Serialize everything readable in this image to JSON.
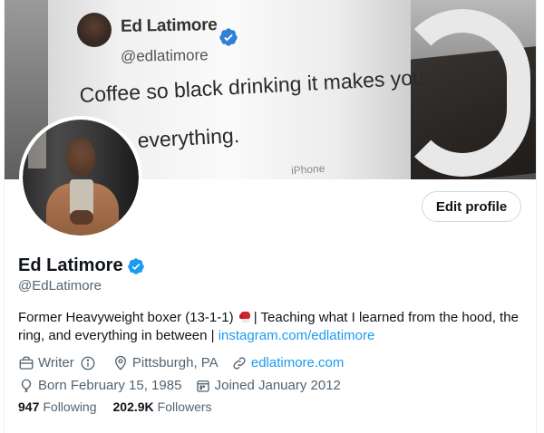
{
  "banner": {
    "tweet_name": "Ed Latimore",
    "tweet_handle": "@edlatimore",
    "tweet_line1": "Coffee so black drinking it makes you",
    "tweet_line2": "everything.",
    "tweet_footer": "iPhone"
  },
  "profile": {
    "display_name": "Ed Latimore",
    "handle": "@EdLatimore",
    "edit_label": "Edit profile",
    "bio_text": "Former Heavyweight boxer (13-1-1)",
    "bio_text2": "| Teaching what I learned from the hood, the ring, and everything in between |",
    "bio_link": "instagram.com/edlatimore",
    "meta": {
      "category": "Writer",
      "location": "Pittsburgh, PA",
      "website": "edlatimore.com",
      "born": "Born February 15, 1985",
      "joined": "Joined January 2012"
    },
    "following_count": "947",
    "following_label": "Following",
    "followers_count": "202.9K",
    "followers_label": "Followers"
  },
  "colors": {
    "accent": "#1d9bf0",
    "secondary_text": "#536471",
    "primary_text": "#0f1419"
  }
}
